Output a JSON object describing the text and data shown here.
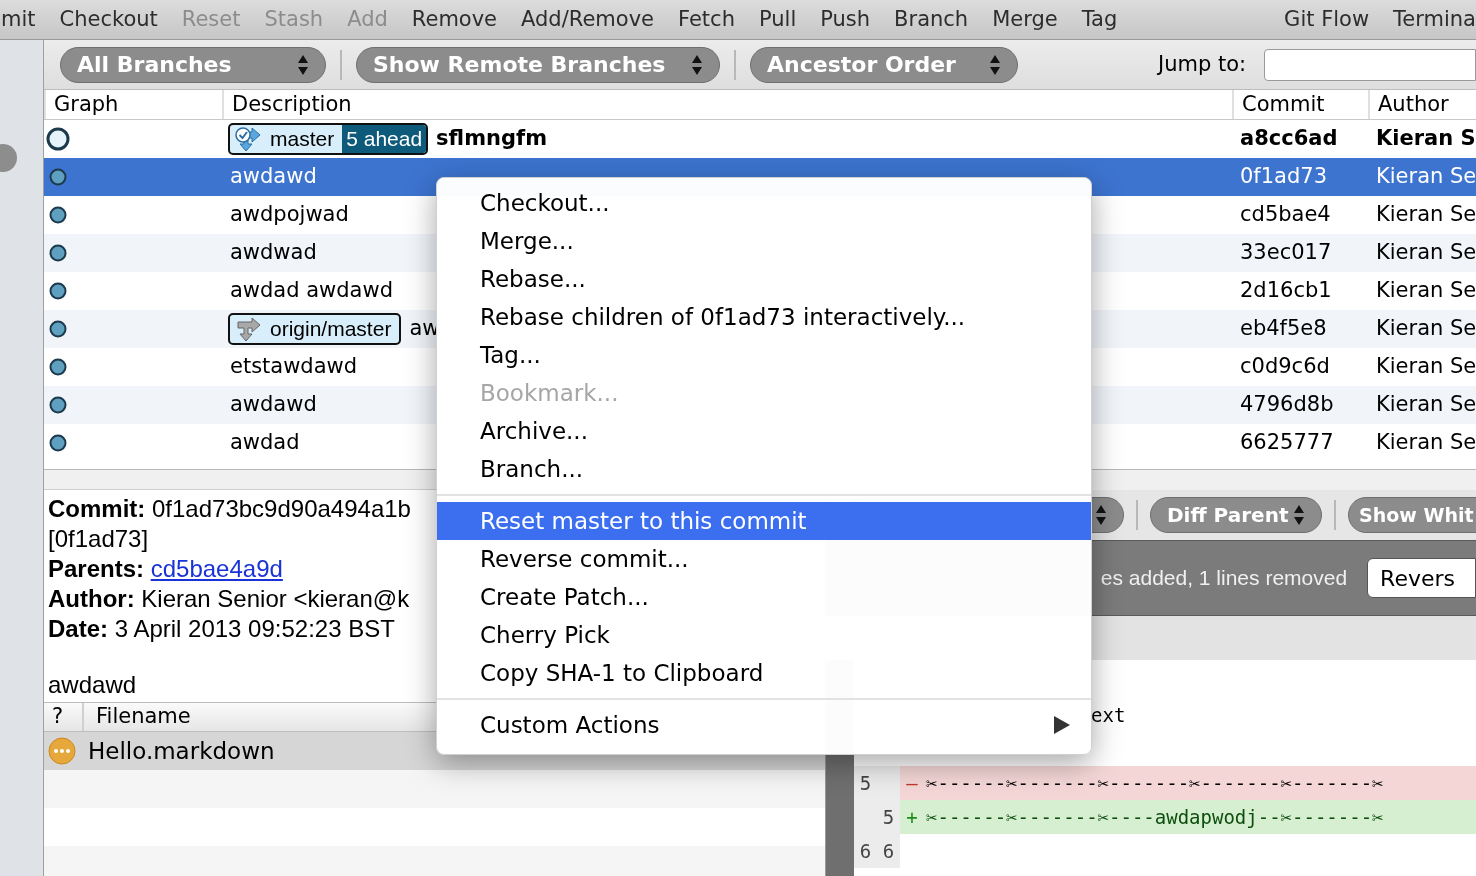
{
  "toolbar": {
    "items": [
      {
        "label": "mit",
        "disabled": false
      },
      {
        "label": "Checkout",
        "disabled": false
      },
      {
        "label": "Reset",
        "disabled": true
      },
      {
        "label": "Stash",
        "disabled": true
      },
      {
        "label": "Add",
        "disabled": true
      },
      {
        "label": "Remove",
        "disabled": false
      },
      {
        "label": "Add/Remove",
        "disabled": false
      },
      {
        "label": "Fetch",
        "disabled": false
      },
      {
        "label": "Pull",
        "disabled": false
      },
      {
        "label": "Push",
        "disabled": false
      },
      {
        "label": "Branch",
        "disabled": false
      },
      {
        "label": "Merge",
        "disabled": false
      },
      {
        "label": "Tag",
        "disabled": false
      }
    ],
    "right_items": [
      {
        "label": "Git Flow",
        "disabled": false
      },
      {
        "label": "Termina",
        "disabled": false
      }
    ]
  },
  "filters": [
    {
      "label": "All Branches"
    },
    {
      "label": "Show Remote Branches"
    },
    {
      "label": "Ancestor Order"
    }
  ],
  "jump_to": {
    "label": "Jump to:"
  },
  "table": {
    "columns": [
      "Graph",
      "Description",
      "Commit",
      "Author"
    ],
    "rows": [
      {
        "refs": [
          {
            "kind": "local",
            "name": "master",
            "ahead": "5 ahead"
          }
        ],
        "description": "sflmngfm",
        "commit": "a8cc6ad",
        "author": "Kieran S",
        "current": true,
        "selected": false
      },
      {
        "description": "awdawd",
        "commit": "0f1ad73",
        "author": "Kieran Se",
        "current": false,
        "selected": true
      },
      {
        "description": "awdpojwad",
        "commit": "cd5bae4",
        "author": "Kieran Se",
        "current": false,
        "selected": false
      },
      {
        "description": "awdwad",
        "commit": "33ec017",
        "author": "Kieran Se",
        "current": false,
        "selected": false
      },
      {
        "description": "awdad awdawd",
        "commit": "2d16cb1",
        "author": "Kieran Se",
        "current": false,
        "selected": false
      },
      {
        "refs": [
          {
            "kind": "remote",
            "name": "origin/master"
          }
        ],
        "description": "aw",
        "commit": "eb4f5e8",
        "author": "Kieran Se",
        "current": false,
        "selected": false
      },
      {
        "description": "etstawdawd",
        "commit": "c0d9c6d",
        "author": "Kieran Se",
        "current": false,
        "selected": false
      },
      {
        "description": "awdawd",
        "commit": "4796d8b",
        "author": "Kieran Se",
        "current": false,
        "selected": false
      },
      {
        "description": "awdad",
        "commit": "6625777",
        "author": "Kieran Se",
        "current": false,
        "selected": false
      }
    ]
  },
  "details": {
    "lines": [
      {
        "label": "Commit:",
        "value": "0f1ad73bc9d90a494a1b",
        "kind": "text"
      },
      {
        "value": "[0f1ad73]",
        "kind": "text"
      },
      {
        "label": "Parents:",
        "value": "cd5bae4a9d",
        "kind": "link"
      },
      {
        "label": "Author:",
        "value": "Kieran Senior <kieran@k",
        "kind": "text"
      },
      {
        "label": "Date:",
        "value": "3 April 2013 09:52:23 BST",
        "kind": "text"
      }
    ],
    "message": "awdawd"
  },
  "files": {
    "columns": [
      "?",
      "Filename"
    ],
    "rows": [
      {
        "name": "Hello.markdown",
        "selected": true
      }
    ]
  },
  "diff": {
    "toolbar": [
      {
        "label": "Diff Parent"
      },
      {
        "label": "Show Whit"
      }
    ],
    "summary": "es added, 1 lines removed",
    "reverse_button": "Revers",
    "lines": [
      {
        "kind": "clipped",
        "text": "ext"
      },
      {
        "kind": "removed",
        "old": "5",
        "sign": "–",
        "text": "✂------✂-------✂-------✂-------✂-------✂"
      },
      {
        "kind": "added",
        "new": "5",
        "sign": "+",
        "text": "✂------✂-------✂----awdapwodj--✂-------✂"
      },
      {
        "kind": "context",
        "old": "6",
        "new": "6"
      }
    ]
  },
  "context_menu": {
    "items": [
      {
        "kind": "item",
        "label": "Checkout...",
        "disabled": false,
        "selected": false
      },
      {
        "kind": "item",
        "label": "Merge...",
        "disabled": false,
        "selected": false
      },
      {
        "kind": "item",
        "label": "Rebase...",
        "disabled": false,
        "selected": false
      },
      {
        "kind": "item",
        "label": "Rebase children of 0f1ad73 interactively...",
        "disabled": false,
        "selected": false
      },
      {
        "kind": "item",
        "label": "Tag...",
        "disabled": false,
        "selected": false
      },
      {
        "kind": "item",
        "label": "Bookmark...",
        "disabled": true,
        "selected": false
      },
      {
        "kind": "item",
        "label": "Archive...",
        "disabled": false,
        "selected": false
      },
      {
        "kind": "item",
        "label": "Branch...",
        "disabled": false,
        "selected": false
      },
      {
        "kind": "separator"
      },
      {
        "kind": "item",
        "label": "Reset master to this commit",
        "disabled": false,
        "selected": true
      },
      {
        "kind": "item",
        "label": "Reverse commit...",
        "disabled": false,
        "selected": false
      },
      {
        "kind": "item",
        "label": "Create Patch...",
        "disabled": false,
        "selected": false
      },
      {
        "kind": "item",
        "label": "Cherry Pick",
        "disabled": false,
        "selected": false
      },
      {
        "kind": "item",
        "label": "Copy SHA-1 to Clipboard",
        "disabled": false,
        "selected": false
      },
      {
        "kind": "separator"
      },
      {
        "kind": "submenu",
        "label": "Custom Actions",
        "disabled": false,
        "selected": false
      }
    ]
  }
}
